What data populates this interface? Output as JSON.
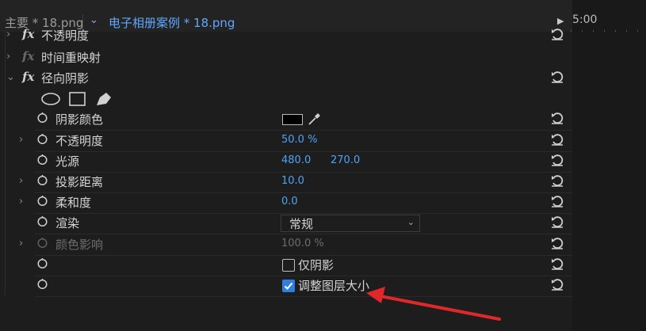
{
  "tabs": {
    "source_label": "主要 * 18.png",
    "active_label": "电子相册案例 * 18.png",
    "timecode": "5:00"
  },
  "effects": {
    "opacity_label": "不透明度",
    "time_remap_label": "时间重映射",
    "radial_shadow_label": "径向阴影"
  },
  "params": [
    {
      "label": "阴影颜色",
      "color": "#000000"
    },
    {
      "label": "不透明度",
      "value": "50.0 %"
    },
    {
      "label": "光源",
      "x": "480.0",
      "y": "270.0"
    },
    {
      "label": "投影距离",
      "value": "10.0"
    },
    {
      "label": "柔和度",
      "value": "0.0"
    },
    {
      "label": "渲染",
      "value": "常规"
    },
    {
      "label": "颜色影响",
      "value": "100.0 %"
    },
    {
      "label": "仅阴影",
      "checked": false
    },
    {
      "label": "调整图层大小",
      "checked": true
    }
  ],
  "colors": {
    "accent": "#4fa3f7",
    "arrow": "#e0282b"
  }
}
